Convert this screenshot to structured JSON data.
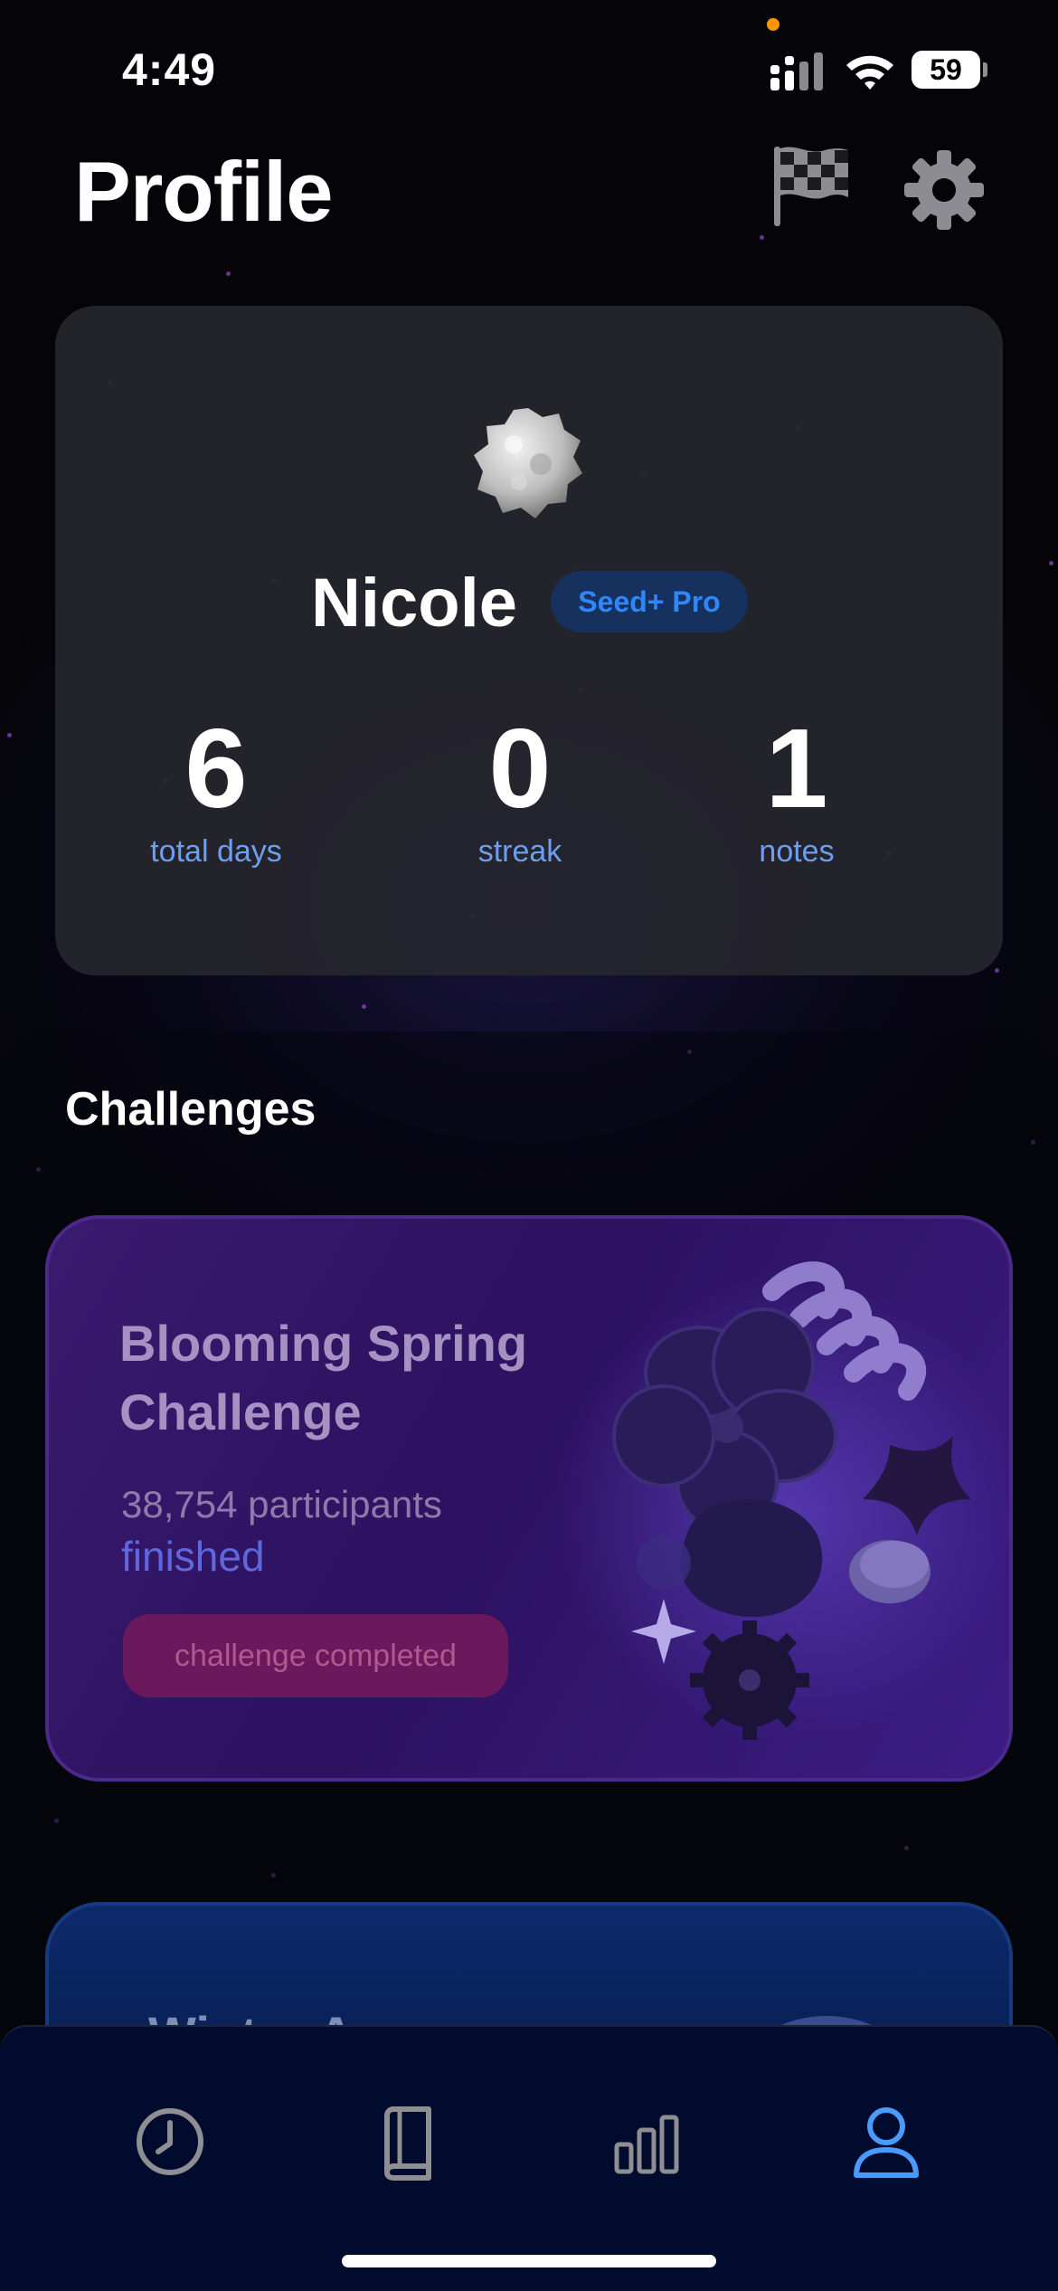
{
  "status_bar": {
    "time": "4:49",
    "battery": "59"
  },
  "header": {
    "title": "Profile",
    "challenges_icon": "checkered-flag-icon",
    "settings_icon": "gear-icon"
  },
  "profile": {
    "name": "Nicole",
    "badge": "Seed+ Pro",
    "stats": [
      {
        "value": "6",
        "label": "total days"
      },
      {
        "value": "0",
        "label": "streak"
      },
      {
        "value": "1",
        "label": "notes"
      }
    ]
  },
  "challenges": {
    "title": "Challenges",
    "items": [
      {
        "title": "Blooming Spring Challenge",
        "participants": "38,754 participants",
        "status": "finished",
        "button": "challenge completed"
      },
      {
        "title": "Winter Arc"
      }
    ]
  },
  "tab_bar": {
    "tabs": [
      {
        "icon": "clock-icon",
        "active": false
      },
      {
        "icon": "book-icon",
        "active": false
      },
      {
        "icon": "bar-chart-icon",
        "active": false
      },
      {
        "icon": "person-icon",
        "active": true
      }
    ]
  },
  "colors": {
    "background": "#050509",
    "card": "#26262e",
    "accent_blue": "#4a9bff",
    "stat_label": "#6d9ff0",
    "challenge_purple": "#2c1260",
    "completed_button": "#6a1a5c",
    "tab_bar": "#000b2e"
  }
}
